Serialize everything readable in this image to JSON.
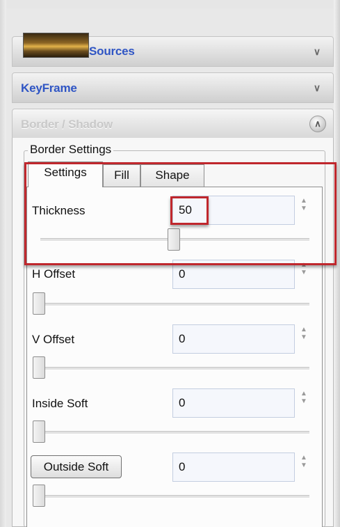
{
  "panels": {
    "sources": {
      "label": "Sources"
    },
    "keyframe": {
      "label": "KeyFrame"
    },
    "border_shadow": {
      "label": "Border / Shadow"
    }
  },
  "border_settings": {
    "group_title": "Border Settings",
    "tabs": [
      {
        "label": "Settings",
        "active": true
      },
      {
        "label": "Fill",
        "active": false
      },
      {
        "label": "Shape",
        "active": false
      }
    ],
    "rows": [
      {
        "label": "Thickness",
        "value": "50",
        "slider_fraction": 0.5
      },
      {
        "label": "H Offset",
        "value": "0",
        "slider_fraction": 0
      },
      {
        "label": "V Offset",
        "value": "0",
        "slider_fraction": 0
      },
      {
        "label": "Inside Soft",
        "value": "0",
        "slider_fraction": 0
      },
      {
        "label": "Outside Soft",
        "value": "0",
        "slider_fraction": 0,
        "is_button": true
      }
    ]
  },
  "colors": {
    "header_text": "#2f55c4",
    "highlight": "#c0272d"
  },
  "icons": {
    "collapse": "chevron-double-down-icon",
    "expand": "chevron-double-up-icon",
    "spinner": "spin-arrows-icon"
  }
}
